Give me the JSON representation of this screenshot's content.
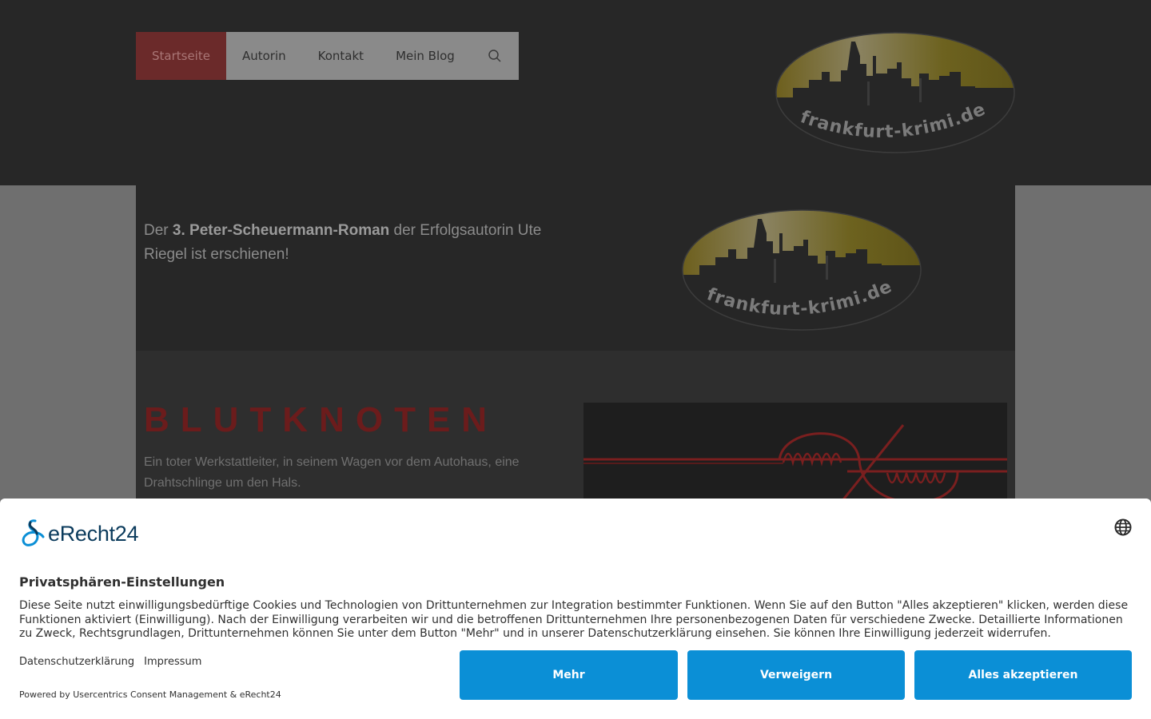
{
  "nav": {
    "items": [
      {
        "label": "Startseite",
        "active": true
      },
      {
        "label": "Autorin",
        "active": false
      },
      {
        "label": "Kontakt",
        "active": false
      },
      {
        "label": "Mein Blog",
        "active": false
      }
    ],
    "search_icon": "search-icon"
  },
  "logo": {
    "text": "frankfurt-krimi.de"
  },
  "hero": {
    "text_before": "Der ",
    "text_bold": "3. Peter-Scheuermann-Roman",
    "text_after": " der Erfolgsautorin Ute Riegel ist erschienen!"
  },
  "book": {
    "title": "BLUTKNOTEN",
    "description": "Ein toter Werkstattleiter, in seinem Wagen vor dem Autohaus, eine Drahtschlinge um den Hals."
  },
  "consent": {
    "brand_name": "eRecht24",
    "title": "Privatsphären-Einstellungen",
    "text": "Diese Seite nutzt einwilligungsbedürftige Cookies und Technologien von Drittunternehmen zur Integration bestimmter Funktionen. Wenn Sie auf den Button \"Alles akzeptieren\" klicken, werden diese Funktionen aktiviert (Einwilligung). Nach der Einwilligung verarbeiten wir und die betroffenen Drittunternehmen Ihre personenbezogenen Daten für verschiedene Zwecke. Detaillierte Informationen zu Zweck, Rechtsgrundlagen, Drittunternehmen können Sie unter dem Button \"Mehr\" und in unserer Datenschutzerklärung einsehen. Sie können Ihre Einwilligung jederzeit widerrufen.",
    "link_privacy": "Datenschutzerklärung",
    "link_imprint": "Impressum",
    "powered_by": "Powered by Usercentrics Consent Management & eRecht24",
    "btn_more": "Mehr",
    "btn_deny": "Verweigern",
    "btn_accept": "Alles akzeptieren"
  },
  "colors": {
    "accent_blue": "#0b8fd6",
    "nav_active": "#6b2a2a",
    "title_red": "#6b1c1c"
  }
}
